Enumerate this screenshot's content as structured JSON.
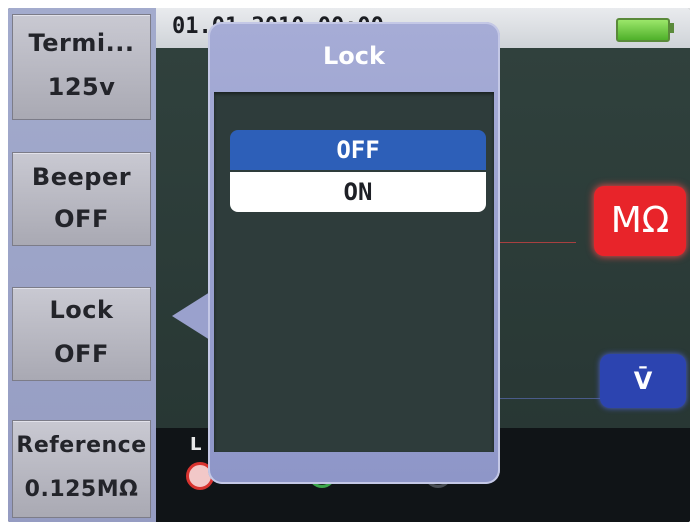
{
  "status": {
    "time": "01.01.2010 00:00"
  },
  "softkeys": [
    {
      "line1": "Termi...",
      "line2": "125v"
    },
    {
      "line1": "Beeper",
      "line2": "OFF"
    },
    {
      "line1": "Lock",
      "line2": "OFF"
    },
    {
      "line1": "Reference",
      "line2": "0.125MΩ"
    }
  ],
  "display": {
    "unit_badge": "MΩ",
    "mode_badge": "V̄",
    "jack_label": "L"
  },
  "popup": {
    "title": "Lock",
    "options": [
      "OFF",
      "ON"
    ],
    "selected": "OFF"
  },
  "colors": {
    "selected_option": "#2d5fb8",
    "unit_badge": "#e8242a",
    "mode_badge": "#2c44b0",
    "battery": "#4fb02a"
  }
}
